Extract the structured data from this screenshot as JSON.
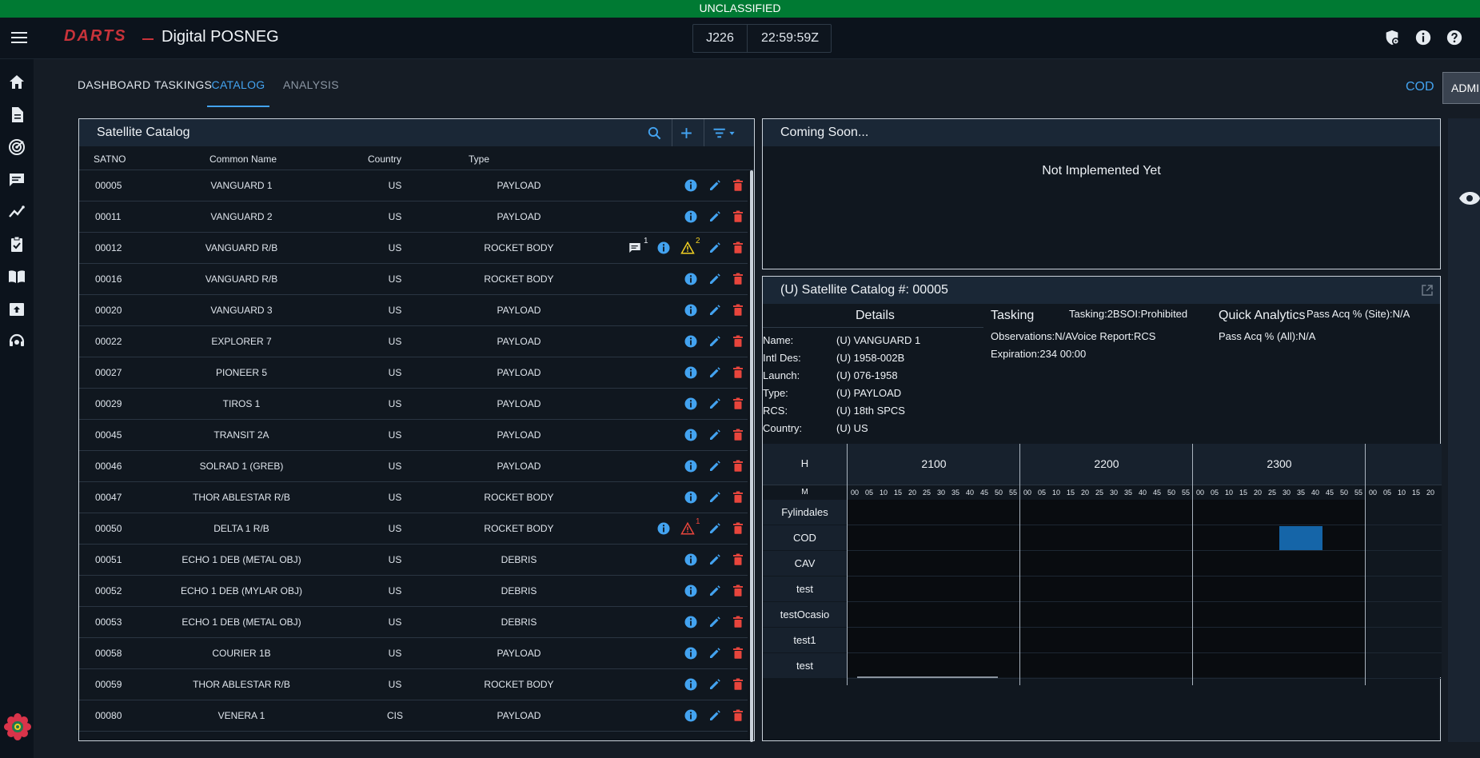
{
  "banner": {
    "text": "UNCLASSIFIED"
  },
  "header": {
    "logo": "DARTS",
    "title": "Digital POSNEG",
    "julian_day": "J226",
    "time": "22:59:59Z"
  },
  "nav": {
    "tabs": [
      {
        "label": "DASHBOARD"
      },
      {
        "label": "TASKINGS"
      },
      {
        "label": "CATALOG"
      },
      {
        "label": "ANALYSIS"
      }
    ],
    "site": "COD",
    "admin_label": "ADMIN"
  },
  "catalog": {
    "title": "Satellite Catalog",
    "columns": {
      "satno": "SATNO",
      "name": "Common Name",
      "country": "Country",
      "type": "Type"
    },
    "rows": [
      {
        "satno": "00005",
        "name": "VANGUARD 1",
        "country": "US",
        "type": "PAYLOAD"
      },
      {
        "satno": "00011",
        "name": "VANGUARD 2",
        "country": "US",
        "type": "PAYLOAD"
      },
      {
        "satno": "00012",
        "name": "VANGUARD R/B",
        "country": "US",
        "type": "ROCKET BODY",
        "comments": "1",
        "warnings": "2"
      },
      {
        "satno": "00016",
        "name": "VANGUARD R/B",
        "country": "US",
        "type": "ROCKET BODY"
      },
      {
        "satno": "00020",
        "name": "VANGUARD 3",
        "country": "US",
        "type": "PAYLOAD"
      },
      {
        "satno": "00022",
        "name": "EXPLORER 7",
        "country": "US",
        "type": "PAYLOAD"
      },
      {
        "satno": "00027",
        "name": "PIONEER 5",
        "country": "US",
        "type": "PAYLOAD"
      },
      {
        "satno": "00029",
        "name": "TIROS 1",
        "country": "US",
        "type": "PAYLOAD"
      },
      {
        "satno": "00045",
        "name": "TRANSIT 2A",
        "country": "US",
        "type": "PAYLOAD"
      },
      {
        "satno": "00046",
        "name": "SOLRAD 1 (GREB)",
        "country": "US",
        "type": "PAYLOAD"
      },
      {
        "satno": "00047",
        "name": "THOR ABLESTAR R/B",
        "country": "US",
        "type": "ROCKET BODY"
      },
      {
        "satno": "00050",
        "name": "DELTA 1 R/B",
        "country": "US",
        "type": "ROCKET BODY",
        "alerts": "1"
      },
      {
        "satno": "00051",
        "name": "ECHO 1 DEB (METAL OBJ)",
        "country": "US",
        "type": "DEBRIS"
      },
      {
        "satno": "00052",
        "name": "ECHO 1 DEB (MYLAR OBJ)",
        "country": "US",
        "type": "DEBRIS"
      },
      {
        "satno": "00053",
        "name": "ECHO 1 DEB (METAL OBJ)",
        "country": "US",
        "type": "DEBRIS"
      },
      {
        "satno": "00058",
        "name": "COURIER 1B",
        "country": "US",
        "type": "PAYLOAD"
      },
      {
        "satno": "00059",
        "name": "THOR ABLESTAR R/B",
        "country": "US",
        "type": "ROCKET BODY"
      },
      {
        "satno": "00080",
        "name": "VENERA 1",
        "country": "CIS",
        "type": "PAYLOAD"
      }
    ]
  },
  "coming_soon": {
    "title": "Coming Soon...",
    "message": "Not Implemented Yet"
  },
  "detail": {
    "title": "(U) Satellite Catalog #: 00005",
    "details_title": "Details",
    "fields": [
      {
        "label": "Name:",
        "value": "(U) VANGUARD 1"
      },
      {
        "label": "Intl Des:",
        "value": "(U) 1958-002B"
      },
      {
        "label": "Launch:",
        "value": "(U) 076-1958"
      },
      {
        "label": "Type:",
        "value": "(U) PAYLOAD"
      },
      {
        "label": "RCS:",
        "value": "(U) 18th SPCS"
      },
      {
        "label": "Country:",
        "value": "(U) US"
      }
    ],
    "tasking_title": "Tasking",
    "tasking": {
      "line1": "Tasking:2BSOI:Prohibited",
      "line2": "Observations:N/AVoice Report:RCS",
      "line3": "Expiration:234 00:00"
    },
    "analytics_title": "Quick Analytics",
    "analytics": {
      "site": "Pass Acq % (Site):N/A",
      "all": "Pass Acq % (All):N/A"
    }
  },
  "schedule": {
    "h_label": "H",
    "m_label": "M",
    "hours": [
      "2100",
      "2200",
      "2300"
    ],
    "minutes": [
      "00",
      "05",
      "10",
      "15",
      "20",
      "25",
      "30",
      "35",
      "40",
      "45",
      "50",
      "55"
    ],
    "partial_minutes": [
      "00",
      "05",
      "10",
      "15",
      "20"
    ],
    "sites": [
      "Fylindales",
      "COD",
      "CAV",
      "test",
      "testOcasio",
      "test1",
      "test"
    ]
  },
  "colors": {
    "accent": "#43a3f0",
    "banner": "#007a33",
    "danger": "#e8453c",
    "warning": "#f2d022",
    "pass_block": "#1565a8"
  }
}
